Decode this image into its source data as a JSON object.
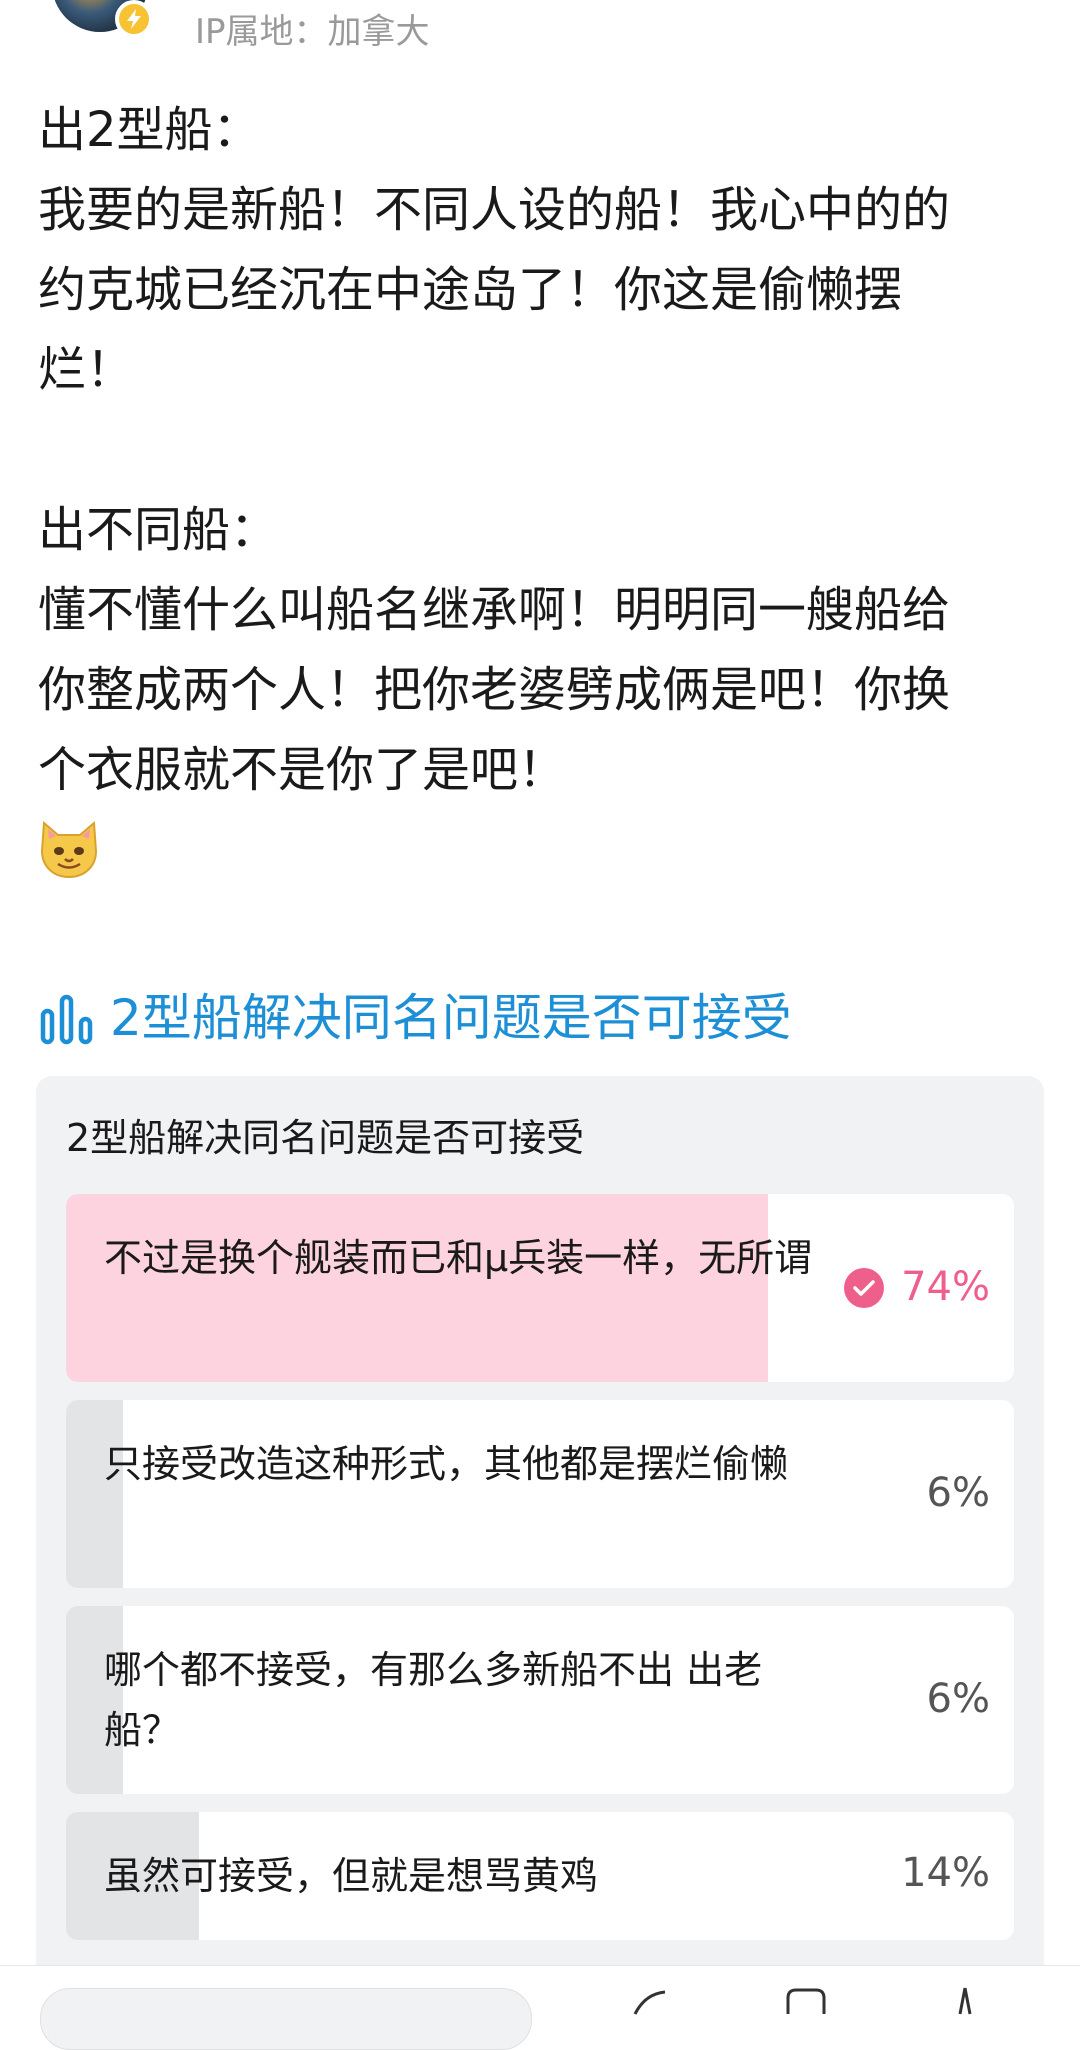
{
  "author": {
    "ip_location": "IP属地：加拿大"
  },
  "post": {
    "body": "出2型船：\n我要的是新船！不同人设的船！我心中的的\n约克城已经沉在中途岛了！你这是偷懒摆\n烂！\n\n出不同船：\n懂不懂什么叫船名继承啊！明明同一艘船给\n你整成两个人！把你老婆劈成俩是吧！你换\n个衣服就不是你了是吧！",
    "emoji": "cat-face-emoji"
  },
  "poll": {
    "heading": "2型船解决同名问题是否可接受",
    "question": "2型船解决同名问题是否可接受",
    "options": [
      {
        "label": "不过是换个舰装而已和μ兵装一样，无所谓",
        "percent": "74%",
        "share": 0.74,
        "selected": true
      },
      {
        "label": "只接受改造这种形式，其他都是摆烂偷懒",
        "percent": "6%",
        "share": 0.06,
        "selected": false
      },
      {
        "label": "哪个都不接受，有那么多新船不出 出老船？",
        "percent": "6%",
        "share": 0.06,
        "selected": false
      },
      {
        "label": "虽然可接受，但就是想骂黄鸡",
        "percent": "14%",
        "share": 0.14,
        "selected": false
      }
    ]
  },
  "colors": {
    "accent_blue": "#1d8fd6",
    "selected_pink": "#ef5f8c",
    "selected_fill": "#fdd3df",
    "unselected_fill": "#e3e4e6"
  }
}
